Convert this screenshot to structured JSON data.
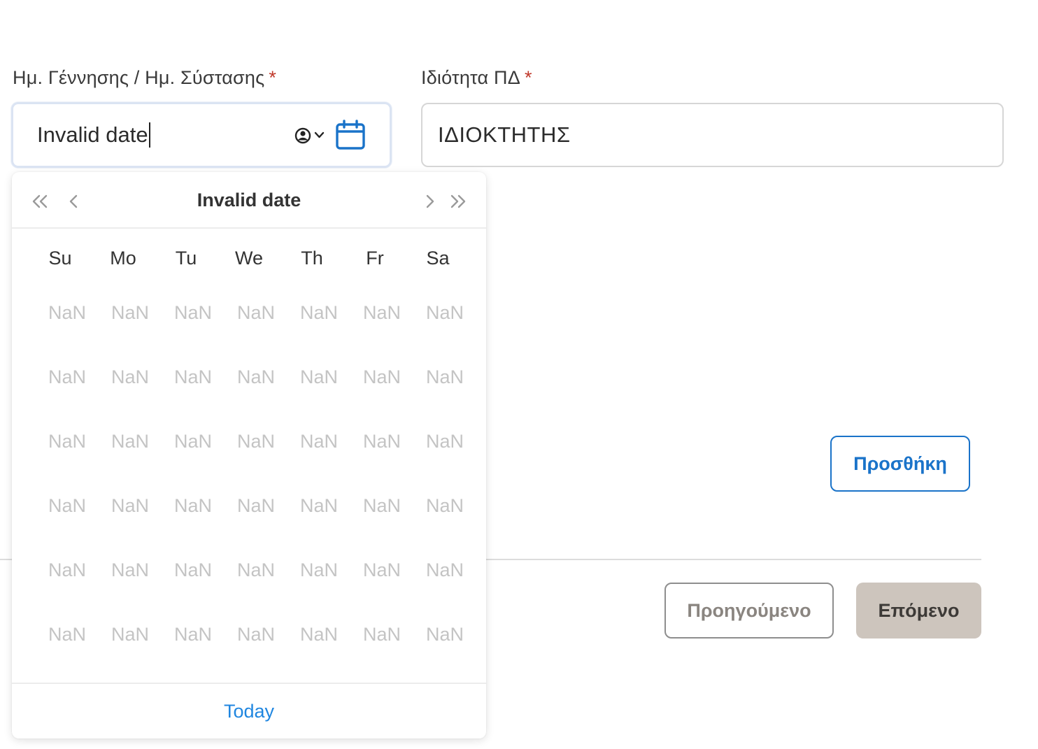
{
  "form": {
    "birth_date_field": {
      "label": "Ημ. Γέννησης / Ημ. Σύστασης",
      "required_mark": "*",
      "value": "Invalid date"
    },
    "role_field": {
      "label": "Ιδιότητα ΠΔ",
      "required_mark": "*",
      "value": "ΙΔΙΟΚΤΗΤΗΣ"
    },
    "add_button_label": "Προσθήκη"
  },
  "calendar": {
    "title": "Invalid date",
    "weekdays": [
      "Su",
      "Mo",
      "Tu",
      "We",
      "Th",
      "Fr",
      "Sa"
    ],
    "weeks": [
      [
        "NaN",
        "NaN",
        "NaN",
        "NaN",
        "NaN",
        "NaN",
        "NaN"
      ],
      [
        "NaN",
        "NaN",
        "NaN",
        "NaN",
        "NaN",
        "NaN",
        "NaN"
      ],
      [
        "NaN",
        "NaN",
        "NaN",
        "NaN",
        "NaN",
        "NaN",
        "NaN"
      ],
      [
        "NaN",
        "NaN",
        "NaN",
        "NaN",
        "NaN",
        "NaN",
        "NaN"
      ],
      [
        "NaN",
        "NaN",
        "NaN",
        "NaN",
        "NaN",
        "NaN",
        "NaN"
      ],
      [
        "NaN",
        "NaN",
        "NaN",
        "NaN",
        "NaN",
        "NaN",
        "NaN"
      ]
    ],
    "today_label": "Today",
    "icons": {
      "prev_year": "double-chevron-left-icon",
      "prev_month": "chevron-left-icon",
      "next_month": "chevron-right-icon",
      "next_year": "double-chevron-right-icon"
    }
  },
  "navigation": {
    "previous_label": "Προηγούμενο",
    "next_label": "Επόμενο"
  },
  "colors": {
    "required": "#c0392b",
    "accent_blue": "#1a73c9",
    "today_link": "#1f86e0",
    "next_button_bg": "#cdc5bd",
    "disabled_day": "#c4c4c4"
  }
}
